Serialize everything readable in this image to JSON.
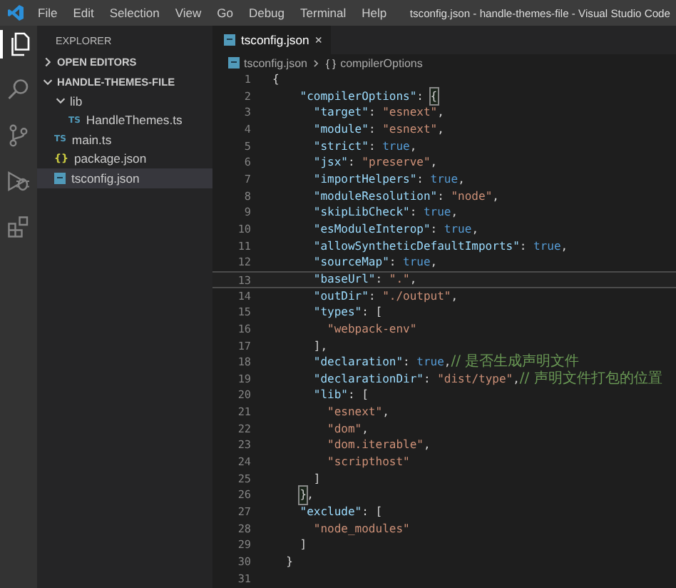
{
  "title_bar": {
    "menu": [
      "File",
      "Edit",
      "Selection",
      "View",
      "Go",
      "Debug",
      "Terminal",
      "Help"
    ],
    "title": "tsconfig.json - handle-themes-file - Visual Studio Code"
  },
  "activity_bar": [
    {
      "kind": "files",
      "selected": true
    },
    {
      "kind": "search",
      "selected": false
    },
    {
      "kind": "source-control",
      "selected": false
    },
    {
      "kind": "debug",
      "selected": false
    },
    {
      "kind": "extensions",
      "selected": false
    }
  ],
  "sidebar": {
    "title": "EXPLORER",
    "sections": [
      {
        "label": "OPEN EDITORS",
        "expanded": false
      },
      {
        "label": "HANDLE-THEMES-FILE",
        "expanded": true
      }
    ],
    "tree": [
      {
        "label": "lib",
        "kind": "folder",
        "expanded": true,
        "selected": false,
        "children": [
          {
            "label": "HandleThemes.ts",
            "kind": "ts",
            "badge": "TS",
            "selected": false
          }
        ]
      },
      {
        "label": "main.ts",
        "kind": "ts",
        "badge": "TS",
        "selected": false
      },
      {
        "label": "package.json",
        "kind": "json",
        "badge": "{}",
        "selected": false
      },
      {
        "label": "tsconfig.json",
        "kind": "config",
        "selected": true
      }
    ]
  },
  "editor": {
    "tabs": [
      {
        "label": "tsconfig.json",
        "close": "×",
        "selected": true
      }
    ],
    "breadcrumb": [
      {
        "label": "tsconfig.json",
        "kind": "file"
      },
      {
        "label": "compilerOptions",
        "kind": "object",
        "symbol": "{ }"
      }
    ],
    "lines": [
      {
        "number": "1",
        "current": false,
        "tokens": [
          {
            "text": "{",
            "kind": "punct"
          }
        ]
      },
      {
        "number": "2",
        "current": false,
        "tokens": [
          {
            "text": "    \"compilerOptions\"",
            "kind": "key"
          },
          {
            "text": ": ",
            "kind": "punct"
          },
          {
            "text": "{",
            "kind": "matched"
          }
        ]
      },
      {
        "number": "3",
        "current": false,
        "tokens": [
          {
            "text": "      \"target\"",
            "kind": "key"
          },
          {
            "text": ": ",
            "kind": "punct"
          },
          {
            "text": "\"esnext\"",
            "kind": "string"
          },
          {
            "text": ",",
            "kind": "punct"
          }
        ]
      },
      {
        "number": "4",
        "current": false,
        "tokens": [
          {
            "text": "      \"module\"",
            "kind": "key"
          },
          {
            "text": ": ",
            "kind": "punct"
          },
          {
            "text": "\"esnext\"",
            "kind": "string"
          },
          {
            "text": ",",
            "kind": "punct"
          }
        ]
      },
      {
        "number": "5",
        "current": false,
        "tokens": [
          {
            "text": "      \"strict\"",
            "kind": "key"
          },
          {
            "text": ": ",
            "kind": "punct"
          },
          {
            "text": "true",
            "kind": "bool"
          },
          {
            "text": ",",
            "kind": "punct"
          }
        ]
      },
      {
        "number": "6",
        "current": false,
        "tokens": [
          {
            "text": "      \"jsx\"",
            "kind": "key"
          },
          {
            "text": ": ",
            "kind": "punct"
          },
          {
            "text": "\"preserve\"",
            "kind": "string"
          },
          {
            "text": ",",
            "kind": "punct"
          }
        ]
      },
      {
        "number": "7",
        "current": false,
        "tokens": [
          {
            "text": "      \"importHelpers\"",
            "kind": "key"
          },
          {
            "text": ": ",
            "kind": "punct"
          },
          {
            "text": "true",
            "kind": "bool"
          },
          {
            "text": ",",
            "kind": "punct"
          }
        ]
      },
      {
        "number": "8",
        "current": false,
        "tokens": [
          {
            "text": "      \"moduleResolution\"",
            "kind": "key"
          },
          {
            "text": ": ",
            "kind": "punct"
          },
          {
            "text": "\"node\"",
            "kind": "string"
          },
          {
            "text": ",",
            "kind": "punct"
          }
        ]
      },
      {
        "number": "9",
        "current": false,
        "tokens": [
          {
            "text": "      \"skipLibCheck\"",
            "kind": "key"
          },
          {
            "text": ": ",
            "kind": "punct"
          },
          {
            "text": "true",
            "kind": "bool"
          },
          {
            "text": ",",
            "kind": "punct"
          }
        ]
      },
      {
        "number": "10",
        "current": false,
        "tokens": [
          {
            "text": "      \"esModuleInterop\"",
            "kind": "key"
          },
          {
            "text": ": ",
            "kind": "punct"
          },
          {
            "text": "true",
            "kind": "bool"
          },
          {
            "text": ",",
            "kind": "punct"
          }
        ]
      },
      {
        "number": "11",
        "current": false,
        "tokens": [
          {
            "text": "      \"allowSyntheticDefaultImports\"",
            "kind": "key"
          },
          {
            "text": ": ",
            "kind": "punct"
          },
          {
            "text": "true",
            "kind": "bool"
          },
          {
            "text": ",",
            "kind": "punct"
          }
        ]
      },
      {
        "number": "12",
        "current": false,
        "tokens": [
          {
            "text": "      \"sourceMap\"",
            "kind": "key"
          },
          {
            "text": ": ",
            "kind": "punct"
          },
          {
            "text": "true",
            "kind": "bool"
          },
          {
            "text": ",",
            "kind": "punct"
          }
        ]
      },
      {
        "number": "13",
        "current": true,
        "tokens": [
          {
            "text": "      \"baseUrl\"",
            "kind": "key"
          },
          {
            "text": ": ",
            "kind": "punct"
          },
          {
            "text": "\".\"",
            "kind": "string"
          },
          {
            "text": ",",
            "kind": "punct"
          }
        ]
      },
      {
        "number": "14",
        "current": false,
        "tokens": [
          {
            "text": "      \"outDir\"",
            "kind": "key"
          },
          {
            "text": ": ",
            "kind": "punct"
          },
          {
            "text": "\"./output\"",
            "kind": "string"
          },
          {
            "text": ",",
            "kind": "punct"
          }
        ]
      },
      {
        "number": "15",
        "current": false,
        "tokens": [
          {
            "text": "      \"types\"",
            "kind": "key"
          },
          {
            "text": ": [",
            "kind": "punct"
          }
        ]
      },
      {
        "number": "16",
        "current": false,
        "tokens": [
          {
            "text": "        \"webpack-env\"",
            "kind": "string"
          }
        ]
      },
      {
        "number": "17",
        "current": false,
        "tokens": [
          {
            "text": "      ],",
            "kind": "punct"
          }
        ]
      },
      {
        "number": "18",
        "current": false,
        "tokens": [
          {
            "text": "      \"declaration\"",
            "kind": "key"
          },
          {
            "text": ": ",
            "kind": "punct"
          },
          {
            "text": "true",
            "kind": "bool"
          },
          {
            "text": ",",
            "kind": "punct"
          },
          {
            "text": "// 是否生成声明文件",
            "kind": "comment"
          }
        ]
      },
      {
        "number": "19",
        "current": false,
        "tokens": [
          {
            "text": "      \"declarationDir\"",
            "kind": "key"
          },
          {
            "text": ": ",
            "kind": "punct"
          },
          {
            "text": "\"dist/type\"",
            "kind": "string"
          },
          {
            "text": ",",
            "kind": "punct"
          },
          {
            "text": "// 声明文件打包的位置",
            "kind": "comment"
          }
        ]
      },
      {
        "number": "20",
        "current": false,
        "tokens": [
          {
            "text": "      \"lib\"",
            "kind": "key"
          },
          {
            "text": ": [",
            "kind": "punct"
          }
        ]
      },
      {
        "number": "21",
        "current": false,
        "tokens": [
          {
            "text": "        \"esnext\"",
            "kind": "string"
          },
          {
            "text": ",",
            "kind": "punct"
          }
        ]
      },
      {
        "number": "22",
        "current": false,
        "tokens": [
          {
            "text": "        \"dom\"",
            "kind": "string"
          },
          {
            "text": ",",
            "kind": "punct"
          }
        ]
      },
      {
        "number": "23",
        "current": false,
        "tokens": [
          {
            "text": "        \"dom.iterable\"",
            "kind": "string"
          },
          {
            "text": ",",
            "kind": "punct"
          }
        ]
      },
      {
        "number": "24",
        "current": false,
        "tokens": [
          {
            "text": "        \"scripthost\"",
            "kind": "string"
          }
        ]
      },
      {
        "number": "25",
        "current": false,
        "tokens": [
          {
            "text": "      ]",
            "kind": "punct"
          }
        ]
      },
      {
        "number": "26",
        "current": false,
        "tokens": [
          {
            "text": "    }",
            "kind": "matched"
          },
          {
            "text": ",",
            "kind": "punct"
          }
        ]
      },
      {
        "number": "27",
        "current": false,
        "tokens": [
          {
            "text": "    \"exclude\"",
            "kind": "key"
          },
          {
            "text": ": [",
            "kind": "punct"
          }
        ]
      },
      {
        "number": "28",
        "current": false,
        "tokens": [
          {
            "text": "      \"node_modules\"",
            "kind": "string"
          }
        ]
      },
      {
        "number": "29",
        "current": false,
        "tokens": [
          {
            "text": "    ]",
            "kind": "punct"
          }
        ]
      },
      {
        "number": "30",
        "current": false,
        "tokens": [
          {
            "text": "  }",
            "kind": "punct"
          }
        ]
      },
      {
        "number": "31",
        "current": false
      }
    ]
  }
}
